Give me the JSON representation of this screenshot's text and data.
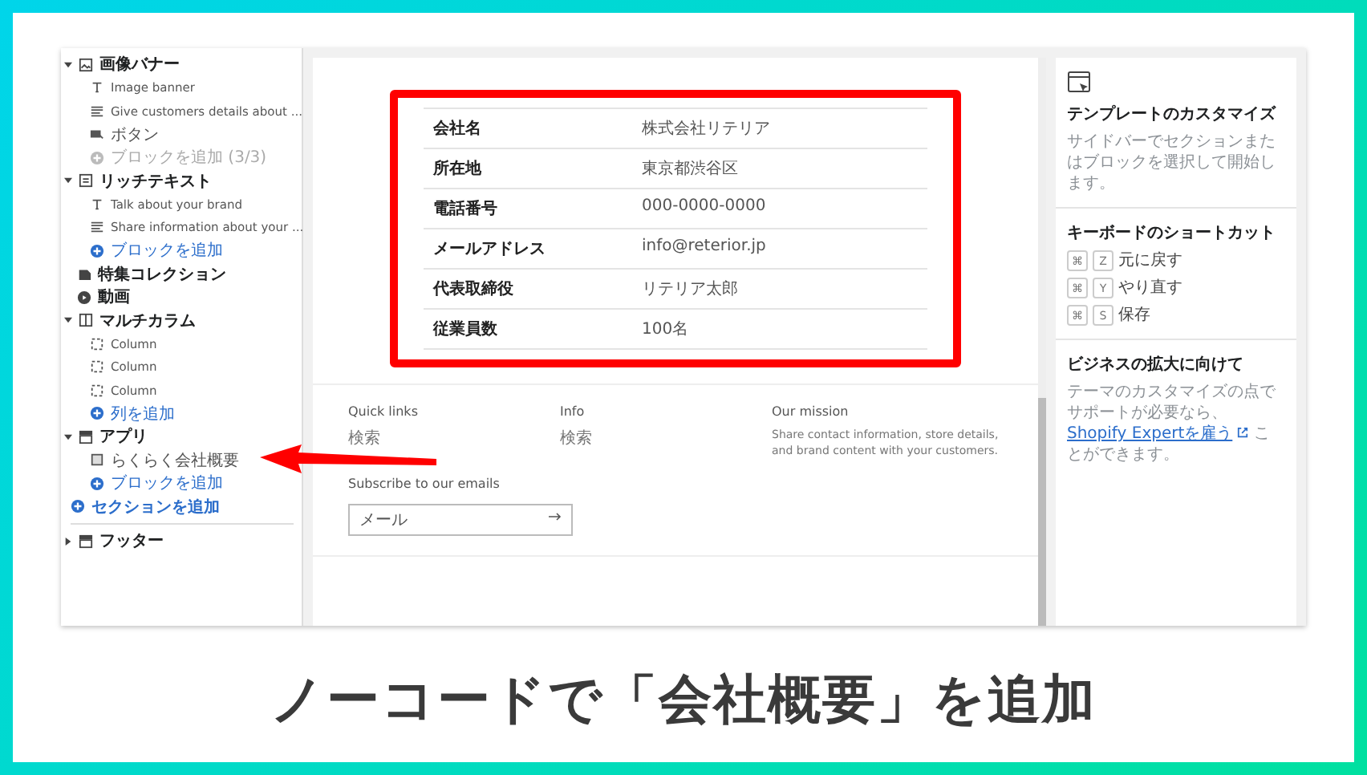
{
  "sidebar": {
    "sections": [
      {
        "kind": "image",
        "label": "画像バナー",
        "expanded": true,
        "children": [
          {
            "kind": "text",
            "label": "Image banner"
          },
          {
            "kind": "lines",
            "label": "Give customers details about ..."
          },
          {
            "kind": "button",
            "label": "ボタン"
          },
          {
            "kind": "add",
            "label": "ブロックを追加 (3/3)",
            "disabled": true
          }
        ]
      },
      {
        "kind": "text",
        "label": "リッチテキスト",
        "expanded": true,
        "children": [
          {
            "kind": "text",
            "label": "Talk about your brand"
          },
          {
            "kind": "lines",
            "label": "Share information about your ..."
          },
          {
            "kind": "add",
            "label": "ブロックを追加",
            "disabled": false
          }
        ]
      },
      {
        "kind": "collection",
        "label": "特集コレクション"
      },
      {
        "kind": "video",
        "label": "動画"
      },
      {
        "kind": "columns",
        "label": "マルチカラム",
        "expanded": true,
        "children": [
          {
            "kind": "column",
            "label": "Column"
          },
          {
            "kind": "column",
            "label": "Column"
          },
          {
            "kind": "column",
            "label": "Column"
          },
          {
            "kind": "add",
            "label": "列を追加",
            "disabled": false
          }
        ]
      },
      {
        "kind": "app",
        "label": "アプリ",
        "expanded": true,
        "children": [
          {
            "kind": "appblock",
            "label": "らくらく会社概要"
          },
          {
            "kind": "add",
            "label": "ブロックを追加",
            "disabled": false
          }
        ]
      }
    ],
    "add_section": "セクションを追加",
    "footer": {
      "kind": "app",
      "label": "フッター",
      "expanded": false
    }
  },
  "company_table": [
    {
      "label": "会社名",
      "value": "株式会社リテリア"
    },
    {
      "label": "所在地",
      "value": "東京都渋谷区"
    },
    {
      "label": "電話番号",
      "value": "000-0000-0000"
    },
    {
      "label": "メールアドレス",
      "value": "info@reterior.jp"
    },
    {
      "label": "代表取締役",
      "value": "リテリア太郎"
    },
    {
      "label": "従業員数",
      "value": "100名"
    }
  ],
  "footer": {
    "columns": [
      {
        "heading": "Quick links",
        "text": "検索"
      },
      {
        "heading": "Info",
        "text": "検索"
      },
      {
        "heading": "Our mission",
        "text": "Share contact information, store details, and brand content with your customers."
      }
    ],
    "subscribe": "Subscribe to our emails",
    "email_placeholder": "メール"
  },
  "right_panel": {
    "title": "テンプレートのカスタマイズ",
    "description": "サイドバーでセクションまたはブロックを選択して開始します。",
    "shortcuts_title": "キーボードのショートカット",
    "shortcuts": [
      {
        "mod": "⌘",
        "key": "Z",
        "label": "元に戻す"
      },
      {
        "mod": "⌘",
        "key": "Y",
        "label": "やり直す"
      },
      {
        "mod": "⌘",
        "key": "S",
        "label": "保存"
      }
    ],
    "grow_title": "ビジネスの拡大に向けて",
    "grow_text": "テーマのカスタマイズの点でサポートが必要なら、",
    "grow_link": "Shopify Expertを雇う",
    "grow_after": "ことができます。"
  },
  "caption": "ノーコードで「会社概要」を追加"
}
